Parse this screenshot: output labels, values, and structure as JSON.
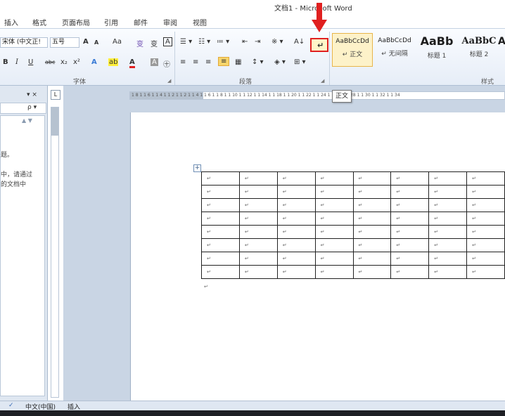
{
  "window": {
    "title": "文档1 - Microsoft Word"
  },
  "tabs": [
    "插入",
    "格式",
    "页面布局",
    "引用",
    "邮件",
    "审阅",
    "视图"
  ],
  "font_group": {
    "font_name": "宋体 (中文正!",
    "font_size": "五号",
    "grow": "A",
    "shrink": "A",
    "change_case": "Aa",
    "phonetic": "变",
    "char_border": "A",
    "bold": "B",
    "italic": "I",
    "underline": "U",
    "strike": "abc",
    "subscript": "x₂",
    "superscript": "x²",
    "text_effect": "A",
    "highlight": "ab",
    "font_color": "A",
    "shading": "A",
    "enclose": "㊉",
    "label": "字体"
  },
  "paragraph_group": {
    "label": "段落",
    "sort": "A↓",
    "show_marks": "↵"
  },
  "styles_group": {
    "label": "样式",
    "items": [
      {
        "sample": "AaBbCcDd",
        "name": "↵ 正文"
      },
      {
        "sample": "AaBbCcDd",
        "name": "↵ 无间隔"
      },
      {
        "sample": "AaBb",
        "name": "标题 1"
      },
      {
        "sample": "AaBbC",
        "name": "标题 2"
      },
      {
        "sample": "A",
        "name": ""
      }
    ]
  },
  "navigation": {
    "close": "▾ ×",
    "search_icon": "ρ ▾",
    "scroll": "▲ ▼",
    "lines": [
      "题。",
      "中，请通过",
      "的文档中"
    ]
  },
  "ruler_button": "L",
  "ruler_marks": "1 8 1  1 6 1  1 4 1  1 2 1     1 2 1  1 4 1  1 6 1  1 8 1  1 10 1  1 12 1  1 14 1   1 18 1  1 20 1  1 22 1  1 24 1  1 26 1  1 28 1  1 30 1  1 32 1  1 34",
  "tooltip": "正文",
  "table": {
    "rows": 8,
    "cols": 8,
    "cell_mark": "↵"
  },
  "document": {
    "after_table_mark": "↵"
  },
  "statusbar": {
    "proof_icon": "✓",
    "language": "中文(中国)",
    "mode": "插入"
  },
  "colors": {
    "accent_red": "#e02020",
    "style_selected": "#fdf2c9",
    "ribbon": "#e6edf7"
  }
}
